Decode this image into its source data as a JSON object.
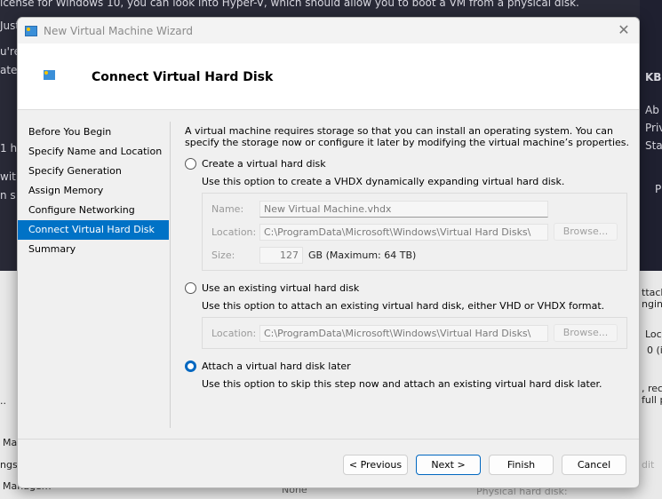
{
  "background": {
    "top_line": "icense for Windows 10, you can look into Hyper-V, which should allow you to boot a VM from a physical disk.",
    "left_fragments": [
      "Just",
      "u're",
      "ate",
      "1 h",
      "with",
      "n s"
    ],
    "right_fragments": [
      "KBI",
      "Ab",
      "Priv",
      "Sta",
      "P",
      "ttach",
      "nging",
      "Loca",
      "0 (i",
      ", rec",
      "full pa",
      "dit"
    ],
    "bottom_left_fragments": [
      "..",
      "Ma",
      "ngs.",
      "Managem"
    ],
    "bottom_center": [
      "None",
      "Physical hard disk:"
    ]
  },
  "window": {
    "title": "New Virtual Machine Wizard",
    "close_glyph": "✕"
  },
  "header": {
    "title": "Connect Virtual Hard Disk"
  },
  "nav": {
    "items": [
      {
        "label": "Before You Begin"
      },
      {
        "label": "Specify Name and Location"
      },
      {
        "label": "Specify Generation"
      },
      {
        "label": "Assign Memory"
      },
      {
        "label": "Configure Networking"
      },
      {
        "label": "Connect Virtual Hard Disk",
        "selected": true
      },
      {
        "label": "Summary"
      }
    ]
  },
  "content": {
    "intro": "A virtual machine requires storage so that you can install an operating system. You can specify the storage now or configure it later by modifying the virtual machine’s properties.",
    "create": {
      "label": "Create a virtual hard disk",
      "selected": false,
      "description": "Use this option to create a VHDX dynamically expanding virtual hard disk.",
      "name_label": "Name:",
      "name_value": "New Virtual Machine.vhdx",
      "location_label": "Location:",
      "location_value": "C:\\ProgramData\\Microsoft\\Windows\\Virtual Hard Disks\\",
      "browse_label": "Browse...",
      "size_label": "Size:",
      "size_value": "127",
      "size_unit": "GB (Maximum: 64 TB)"
    },
    "existing": {
      "label": "Use an existing virtual hard disk",
      "selected": false,
      "description": "Use this option to attach an existing virtual hard disk, either VHD or VHDX format.",
      "location_label": "Location:",
      "location_value": "C:\\ProgramData\\Microsoft\\Windows\\Virtual Hard Disks\\",
      "browse_label": "Browse..."
    },
    "later": {
      "label": "Attach a virtual hard disk later",
      "selected": true,
      "description": "Use this option to skip this step now and attach an existing virtual hard disk later."
    }
  },
  "buttons": {
    "previous": "< Previous",
    "next": "Next >",
    "finish": "Finish",
    "cancel": "Cancel"
  },
  "colors": {
    "accent": "#0072c6",
    "radio_selected": "#0067c0"
  }
}
